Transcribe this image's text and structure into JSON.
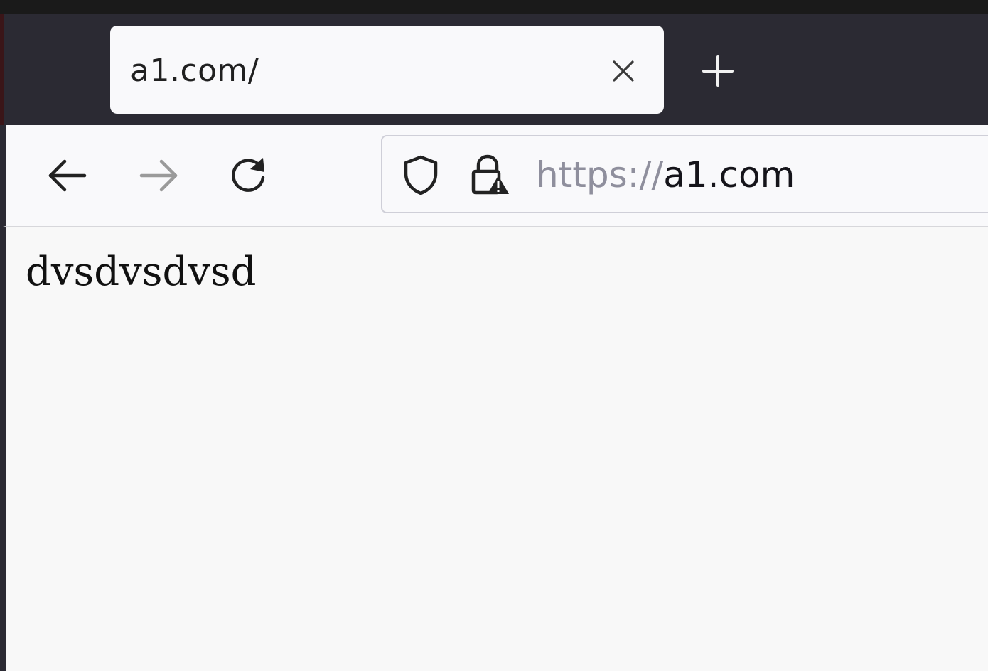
{
  "browser": {
    "tab": {
      "title": "a1.com/",
      "close_icon": "close-icon"
    },
    "new_tab_icon": "plus-icon",
    "nav": {
      "back_icon": "arrow-left-icon",
      "forward_icon": "arrow-right-icon",
      "reload_icon": "reload-icon"
    },
    "urlbar": {
      "shield_icon": "shield-icon",
      "lock_warning_icon": "lock-warning-icon",
      "scheme": "https://",
      "host": "a1.com"
    }
  },
  "page": {
    "text": "dvsdvsdvsd"
  },
  "colors": {
    "tabstrip": "#2b2a33",
    "toolbar": "#f9f9fb",
    "content_bg": "#f8f8f8",
    "url_scheme": "#8f8f9d",
    "url_host": "#15141a"
  }
}
